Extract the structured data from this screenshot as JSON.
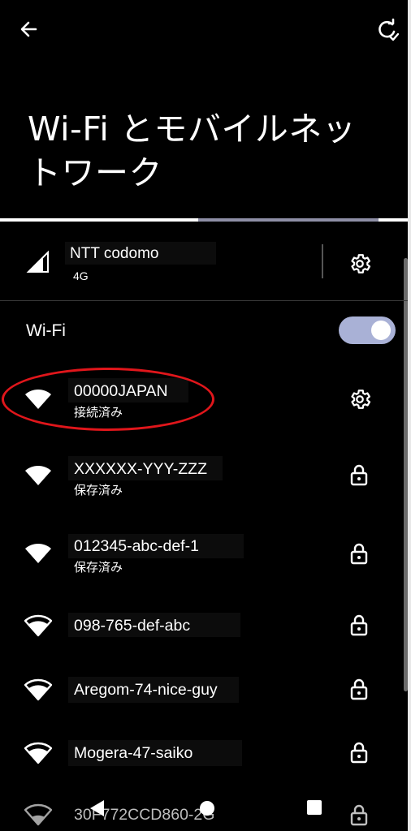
{
  "header": {
    "back_icon": "arrow-left-icon",
    "refresh_icon": "refresh-icon",
    "title_line1": "Wi-Fi とモバイルネッ",
    "title_line2": "トワーク"
  },
  "mobile": {
    "carrier": "NTT codomo",
    "network_type": "4G",
    "signal_icon": "cell-signal-icon",
    "settings_icon": "gear-icon"
  },
  "wifi": {
    "label": "Wi-Fi",
    "enabled": true,
    "networks": [
      {
        "name": "00000JAPAN",
        "status": "接続済み",
        "icon": "wifi-full-icon",
        "action_icon": "gear-icon",
        "highlighted": true
      },
      {
        "name": "XXXXXX-YYY-ZZZ",
        "status": "保存済み",
        "icon": "wifi-full-icon",
        "action_icon": "lock-icon"
      },
      {
        "name": "012345-abc-def-1",
        "status": "保存済み",
        "icon": "wifi-full-icon",
        "action_icon": "lock-icon"
      },
      {
        "name": "098-765-def-abc",
        "status": "",
        "icon": "wifi-strong-icon",
        "action_icon": "lock-icon"
      },
      {
        "name": "Aregom-74-nice-guy",
        "status": "",
        "icon": "wifi-strong-icon",
        "action_icon": "lock-icon"
      },
      {
        "name": "Mogera-47-saiko",
        "status": "",
        "icon": "wifi-strong-icon",
        "action_icon": "lock-icon"
      },
      {
        "name": "30F772CCD860-2G",
        "status": "",
        "icon": "wifi-weak-icon",
        "action_icon": "lock-icon"
      }
    ]
  },
  "navbar": {
    "back": "nav-back-icon",
    "home": "nav-home-icon",
    "recents": "nav-recents-icon"
  },
  "colors": {
    "background": "#000000",
    "toggle_track": "#a9b1d6",
    "highlight_ring": "#e0161b",
    "tab_indicator": "#8e8fa6"
  }
}
